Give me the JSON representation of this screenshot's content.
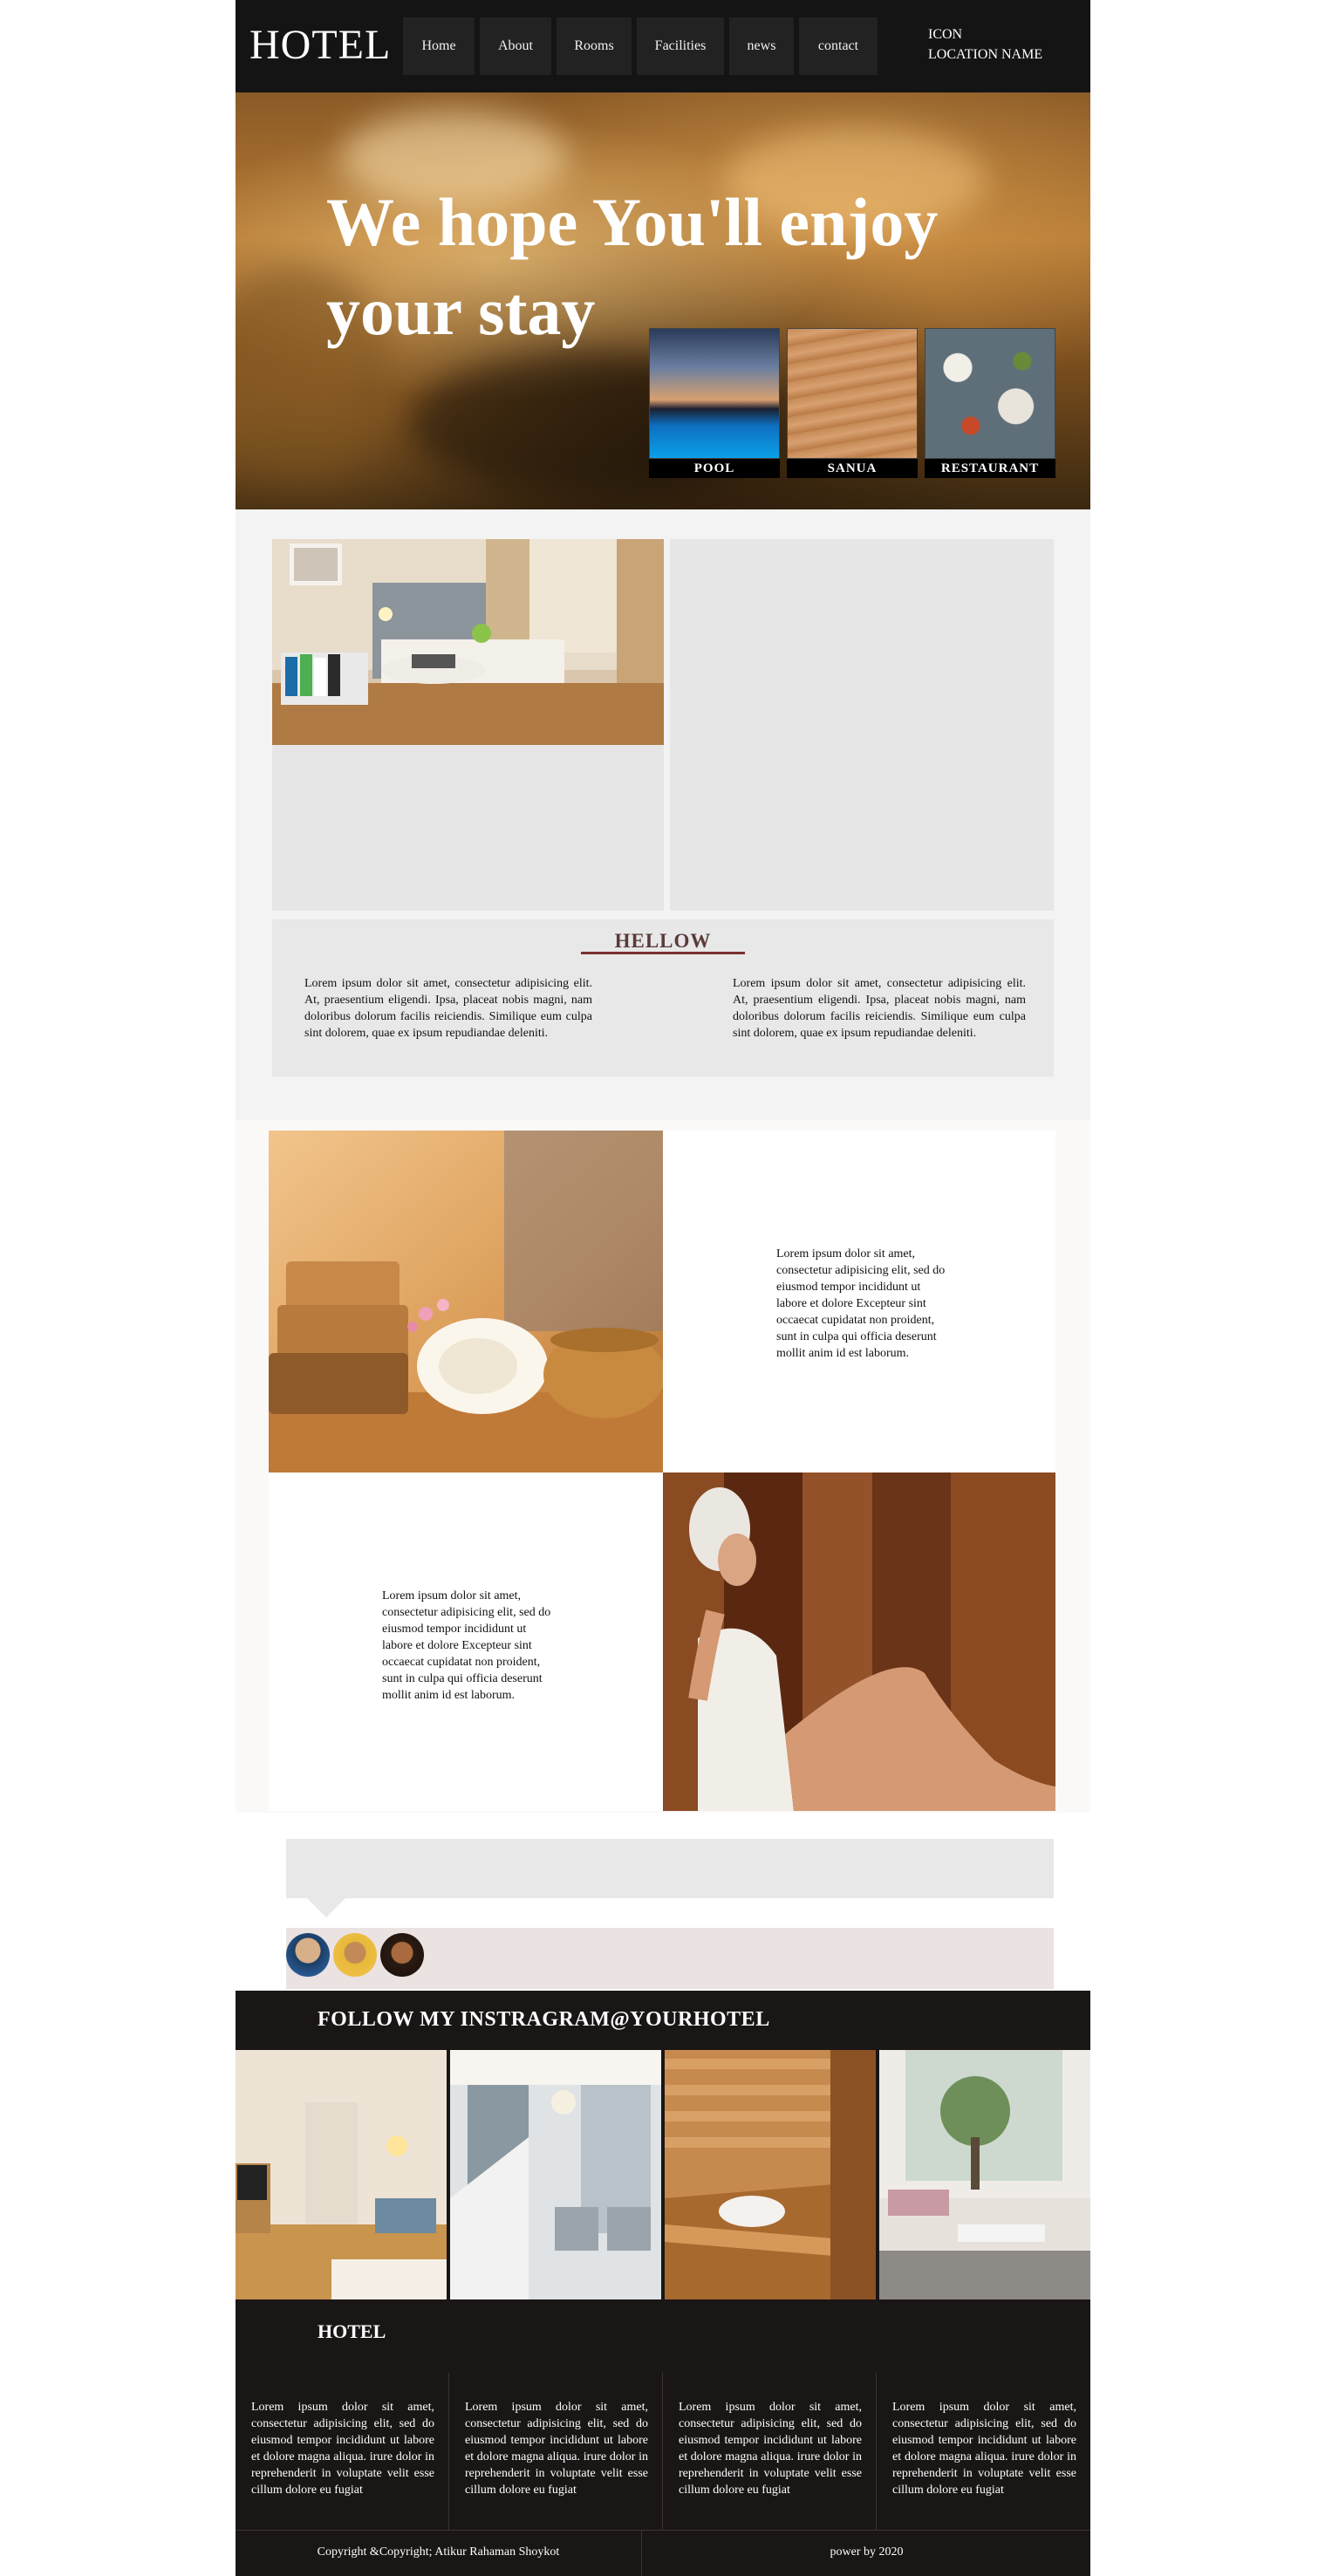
{
  "header": {
    "logo": "HOTEL",
    "nav": [
      {
        "label": "Home",
        "name": "nav-home"
      },
      {
        "label": "About",
        "name": "nav-about"
      },
      {
        "label": "Rooms",
        "name": "nav-rooms"
      },
      {
        "label": "Facilities",
        "name": "nav-facilities"
      },
      {
        "label": "news",
        "name": "nav-news"
      },
      {
        "label": "contact",
        "name": "nav-contact"
      }
    ],
    "icon_label": "ICON",
    "location_label": "LOCATION NAME"
  },
  "hero": {
    "title": "We hope You'll enjoy your stay",
    "features": [
      {
        "label": "POOL"
      },
      {
        "label": "SANUA"
      },
      {
        "label": "RESTAURANT"
      }
    ]
  },
  "about": {
    "heading": "HELLOW",
    "paragraph_left": "Lorem ipsum dolor sit amet, consectetur adipisicing elit. At, praesentium eligendi. Ipsa, placeat nobis magni, nam doloribus dolorum facilis reiciendis. Similique eum culpa sint dolorem, quae ex ipsum repudiandae deleniti.",
    "paragraph_right": "Lorem ipsum dolor sit amet, consectetur adipisicing elit. At, praesentium eligendi. Ipsa, placeat nobis magni, nam doloribus dolorum facilis reiciendis. Similique eum culpa sint dolorem, quae ex ipsum repudiandae deleniti."
  },
  "spa": {
    "text_1": "Lorem ipsum dolor sit amet, consectetur adipisicing elit, sed do eiusmod tempor incididunt ut labore et dolore Excepteur sint occaecat cupidatat non proident, sunt in culpa qui officia deserunt mollit anim id est laborum.",
    "text_2": "Lorem ipsum dolor sit amet, consectetur adipisicing elit, sed do eiusmod tempor incididunt ut labore et dolore Excepteur sint occaecat cupidatat non proident, sunt in culpa qui officia deserunt mollit anim id est laborum."
  },
  "instagram": {
    "title": "FOLLOW MY INSTRAGRAM@YOURHOTEL"
  },
  "footer": {
    "title": "HOTEL",
    "columns": [
      "Lorem ipsum dolor sit amet, consectetur adipisicing elit, sed do eiusmod tempor incididunt ut labore et dolore magna aliqua. irure dolor in reprehenderit in voluptate velit esse cillum dolore eu fugiat",
      "Lorem ipsum dolor sit amet, consectetur adipisicing elit, sed do eiusmod tempor incididunt ut labore et dolore magna aliqua. irure dolor in reprehenderit in voluptate velit esse cillum dolore eu fugiat",
      "Lorem ipsum dolor sit amet, consectetur adipisicing elit, sed do eiusmod tempor incididunt ut labore et dolore magna aliqua. irure dolor in reprehenderit in voluptate velit esse cillum dolore eu fugiat",
      "Lorem ipsum dolor sit amet, consectetur adipisicing elit, sed do eiusmod tempor incididunt ut labore et dolore magna aliqua. irure dolor in reprehenderit in voluptate velit esse cillum dolore eu fugiat"
    ],
    "copyright": "Copyright &Copyright; Atikur Rahaman Shoykot",
    "powered": "power by 2020"
  }
}
